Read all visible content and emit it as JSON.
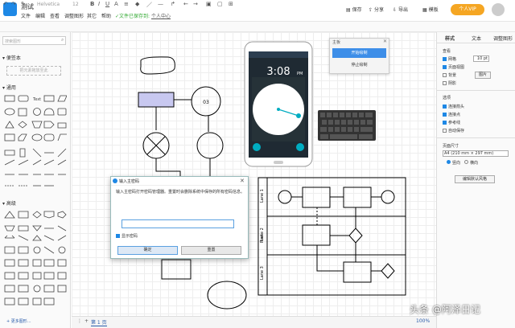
{
  "app": {
    "title": "测试",
    "saved_status": "✓文件已保存到:",
    "login_link": "个人中心"
  },
  "menu": [
    "文件",
    "编辑",
    "查看",
    "调整图形",
    "其它",
    "帮助"
  ],
  "header_buttons": {
    "save": "保存",
    "share": "分享",
    "export": "导出",
    "template": "模板",
    "vip": "个人VIP"
  },
  "toolbar": {
    "font": "Helvetica",
    "size": "12"
  },
  "left_panel": {
    "search_placeholder": "搜索图形",
    "scratchpad": "便签本",
    "drop_hint": "把元素拖放至此",
    "general": "通用",
    "advanced": "高级",
    "more_shapes": "+ 更多图形..."
  },
  "right_panel": {
    "tabs": [
      "样式",
      "文本",
      "调整图形"
    ],
    "view": "查看",
    "grid": "网格",
    "grid_size": "10 pt",
    "page_view": "页面视图",
    "background": "背景",
    "shadow": "阴影",
    "background_btn": "图片",
    "options": "选项",
    "connection_arrows": "连接箭头",
    "connection_points": "连接点",
    "guides": "参考线",
    "autosave": "自动保存",
    "paper_size": "页面尺寸",
    "paper_value": "A4 (210 mm × 297 mm)",
    "portrait": "竖向",
    "landscape": "横向",
    "edit_style_btn": "编辑默认风格"
  },
  "canvas": {
    "node_03": "03",
    "clock_time": "3:08",
    "clock_pm": "PM",
    "lanes": [
      "Lane 1",
      "Lane 2",
      "Lane 3"
    ],
    "pool": "Pool"
  },
  "dialog": {
    "title": "输入主密码",
    "message": "输入主密码打开密码管理器。重置时会删除系统中保存的所有密码信息。",
    "show_password": "显示密码",
    "ok": "确定",
    "reset": "重置"
  },
  "popup": {
    "title": "主板",
    "start": "开始绘制",
    "stop": "停止绘制"
  },
  "status": {
    "page_tab": "第 1 页",
    "zoom": "100%"
  },
  "watermark": "头条 @阿泽日记"
}
